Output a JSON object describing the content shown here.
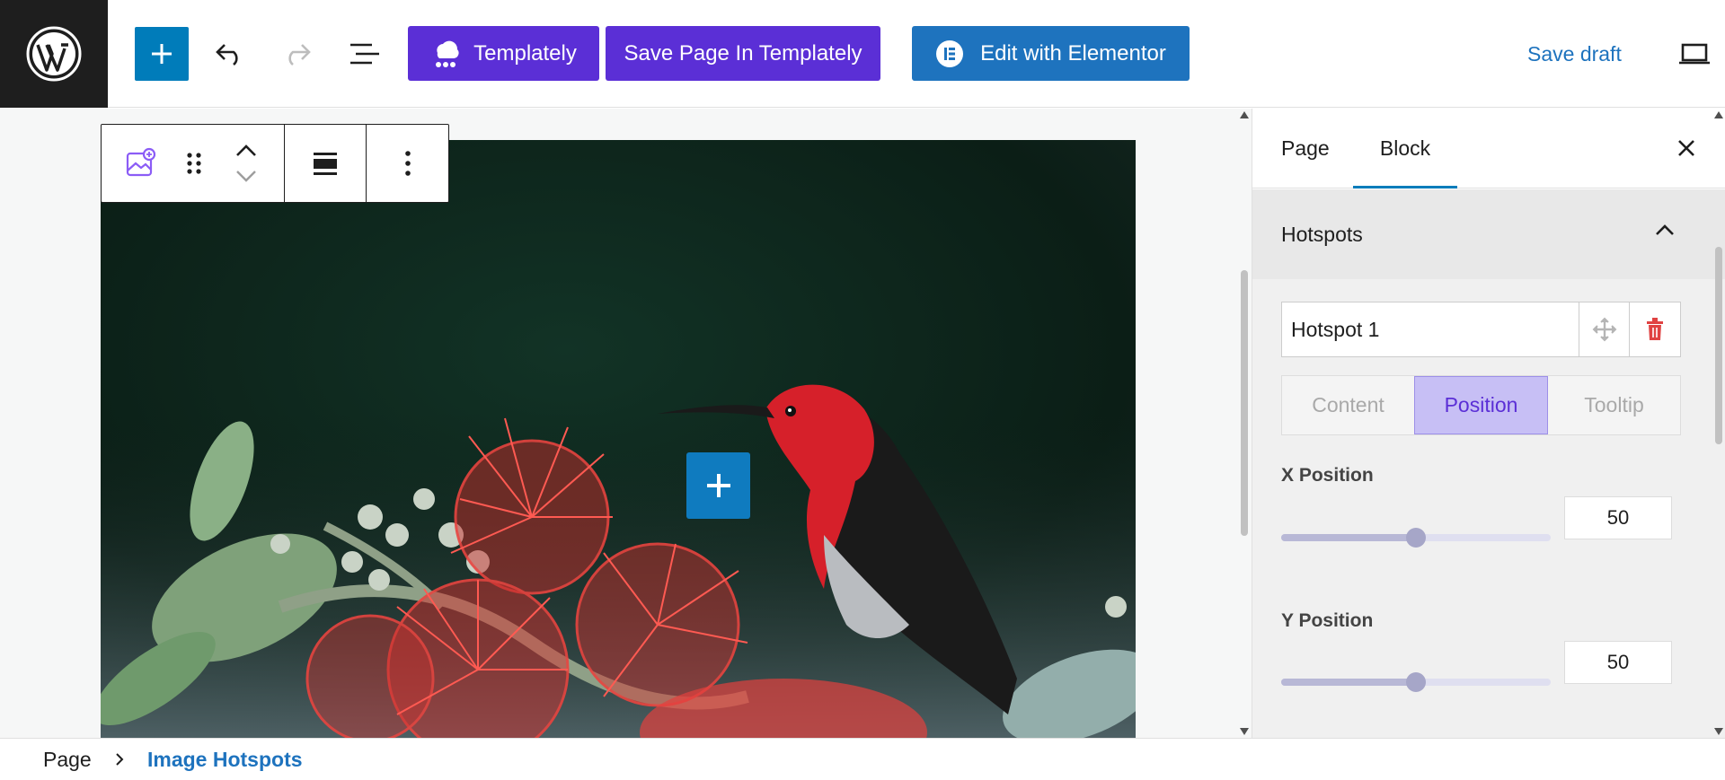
{
  "header": {
    "templately_label": "Templately",
    "save_templately_label": "Save Page In Templately",
    "elementor_label": "Edit with Elementor",
    "save_draft_label": "Save draft",
    "colors": {
      "templately": "#5b2fd6",
      "elementor": "#1e73be",
      "primary": "#007cba"
    }
  },
  "block_toolbar": {
    "icons": [
      "image-hotspot-block-icon",
      "drag-handle-icon",
      "move-up-icon",
      "move-down-icon",
      "align-icon",
      "more-options-icon"
    ]
  },
  "sidebar": {
    "tabs": [
      {
        "label": "Page"
      },
      {
        "label": "Block"
      }
    ],
    "active_tab": "Block",
    "panel": {
      "title": "Hotspots",
      "hotspot": {
        "name": "Hotspot 1"
      },
      "subtabs": [
        "Content",
        "Position",
        "Tooltip"
      ],
      "active_subtab": "Position",
      "x": {
        "label": "X Position",
        "value": "50",
        "fraction": 0.5
      },
      "y": {
        "label": "Y Position",
        "value": "50",
        "fraction": 0.5
      }
    }
  },
  "breadcrumb": {
    "root": "Page",
    "current": "Image Hotspots"
  }
}
